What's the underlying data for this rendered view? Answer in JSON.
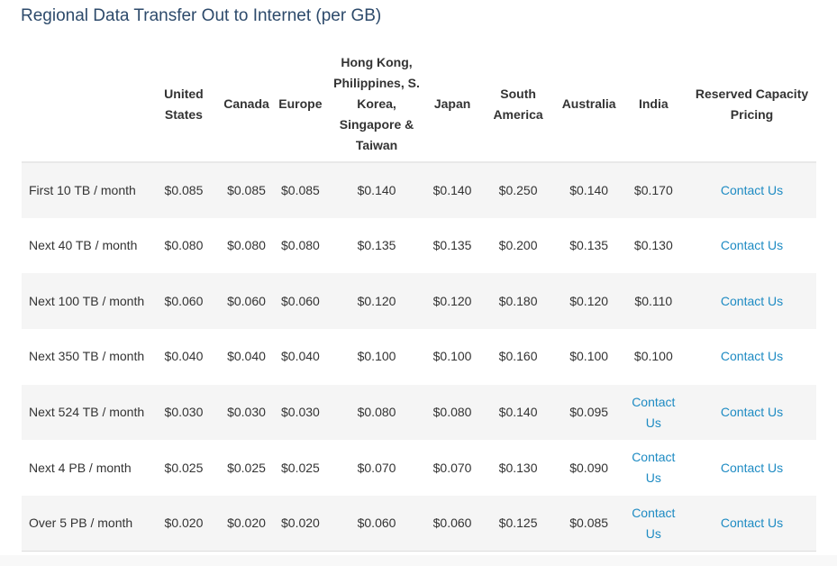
{
  "title": "Regional Data Transfer Out to Internet (per GB)",
  "colors": {
    "title": "#2d4a6b",
    "link": "#1e8bc3",
    "stripe": "#f5f5f5"
  },
  "table": {
    "headers": [
      "",
      "United States",
      "Canada",
      "Europe",
      "Hong Kong, Philippines, S. Korea, Singapore & Taiwan",
      "Japan",
      "South America",
      "Australia",
      "India",
      "Reserved Capacity Pricing"
    ],
    "rows": [
      {
        "tier": "First 10 TB / month",
        "cells": [
          "$0.085",
          "$0.085",
          "$0.085",
          "$0.140",
          "$0.140",
          "$0.250",
          "$0.140",
          "$0.170",
          "Contact Us"
        ]
      },
      {
        "tier": "Next 40 TB / month",
        "cells": [
          "$0.080",
          "$0.080",
          "$0.080",
          "$0.135",
          "$0.135",
          "$0.200",
          "$0.135",
          "$0.130",
          "Contact Us"
        ]
      },
      {
        "tier": "Next 100 TB / month",
        "cells": [
          "$0.060",
          "$0.060",
          "$0.060",
          "$0.120",
          "$0.120",
          "$0.180",
          "$0.120",
          "$0.110",
          "Contact Us"
        ]
      },
      {
        "tier": "Next 350 TB / month",
        "cells": [
          "$0.040",
          "$0.040",
          "$0.040",
          "$0.100",
          "$0.100",
          "$0.160",
          "$0.100",
          "$0.100",
          "Contact Us"
        ]
      },
      {
        "tier": "Next 524 TB / month",
        "cells": [
          "$0.030",
          "$0.030",
          "$0.030",
          "$0.080",
          "$0.080",
          "$0.140",
          "$0.095",
          "Contact Us",
          "Contact Us"
        ]
      },
      {
        "tier": "Next 4 PB / month",
        "cells": [
          "$0.025",
          "$0.025",
          "$0.025",
          "$0.070",
          "$0.070",
          "$0.130",
          "$0.090",
          "Contact Us",
          "Contact Us"
        ]
      },
      {
        "tier": "Over 5 PB / month",
        "cells": [
          "$0.020",
          "$0.020",
          "$0.020",
          "$0.060",
          "$0.060",
          "$0.125",
          "$0.085",
          "Contact Us",
          "Contact Us"
        ]
      }
    ]
  }
}
